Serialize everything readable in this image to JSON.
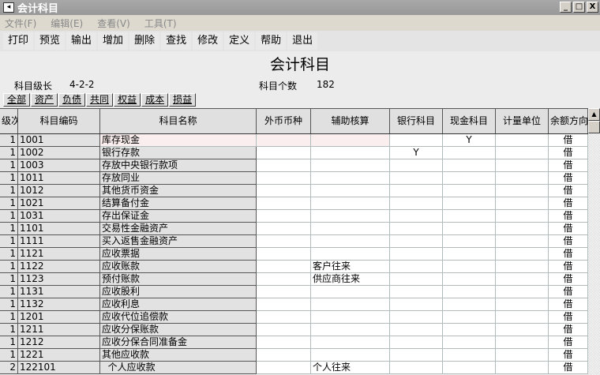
{
  "window": {
    "title": "会计科目",
    "minimize": "_",
    "maximize": "□",
    "close": "X"
  },
  "menu": [
    "文件(F)",
    "编辑(E)",
    "查看(V)",
    "工具(T)"
  ],
  "toolbar": [
    "打印",
    "预览",
    "输出",
    "增加",
    "删除",
    "查找",
    "修改",
    "定义",
    "帮助",
    "退出"
  ],
  "page_title": "会计科目",
  "info": {
    "level_label": "科目级长",
    "level_value": "4-2-2",
    "count_label": "科目个数",
    "count_value": "182"
  },
  "tabs": [
    "全部",
    "资产",
    "负债",
    "共同",
    "权益",
    "成本",
    "损益"
  ],
  "columns": [
    "级次",
    "科目编码",
    "科目名称",
    "外币币种",
    "辅助核算",
    "银行科目",
    "现金科目",
    "计量单位",
    "余额方向"
  ],
  "rows": [
    [
      "1",
      "1001",
      "库存现金",
      "",
      "",
      "",
      "Y",
      "",
      "借"
    ],
    [
      "1",
      "1002",
      "银行存款",
      "",
      "",
      "Y",
      "",
      "",
      "借"
    ],
    [
      "1",
      "1003",
      "存放中央银行款项",
      "",
      "",
      "",
      "",
      "",
      "借"
    ],
    [
      "1",
      "1011",
      "存放同业",
      "",
      "",
      "",
      "",
      "",
      "借"
    ],
    [
      "1",
      "1012",
      "其他货币资金",
      "",
      "",
      "",
      "",
      "",
      "借"
    ],
    [
      "1",
      "1021",
      "结算备付金",
      "",
      "",
      "",
      "",
      "",
      "借"
    ],
    [
      "1",
      "1031",
      "存出保证金",
      "",
      "",
      "",
      "",
      "",
      "借"
    ],
    [
      "1",
      "1101",
      "交易性金融资产",
      "",
      "",
      "",
      "",
      "",
      "借"
    ],
    [
      "1",
      "1111",
      "买入返售金融资产",
      "",
      "",
      "",
      "",
      "",
      "借"
    ],
    [
      "1",
      "1121",
      "应收票据",
      "",
      "",
      "",
      "",
      "",
      "借"
    ],
    [
      "1",
      "1122",
      "应收账款",
      "",
      "客户往来",
      "",
      "",
      "",
      "借"
    ],
    [
      "1",
      "1123",
      "预付账款",
      "",
      "供应商往来",
      "",
      "",
      "",
      "借"
    ],
    [
      "1",
      "1131",
      "应收股利",
      "",
      "",
      "",
      "",
      "",
      "借"
    ],
    [
      "1",
      "1132",
      "应收利息",
      "",
      "",
      "",
      "",
      "",
      "借"
    ],
    [
      "1",
      "1201",
      "应收代位追偿款",
      "",
      "",
      "",
      "",
      "",
      "借"
    ],
    [
      "1",
      "1211",
      "应收分保账款",
      "",
      "",
      "",
      "",
      "",
      "借"
    ],
    [
      "1",
      "1212",
      "应收分保合同准备金",
      "",
      "",
      "",
      "",
      "",
      "借"
    ],
    [
      "1",
      "1221",
      "其他应收款",
      "",
      "",
      "",
      "",
      "",
      "借"
    ],
    [
      "2",
      "122101",
      "  个人应收款",
      "",
      "个人往来",
      "",
      "",
      "",
      "借"
    ]
  ]
}
